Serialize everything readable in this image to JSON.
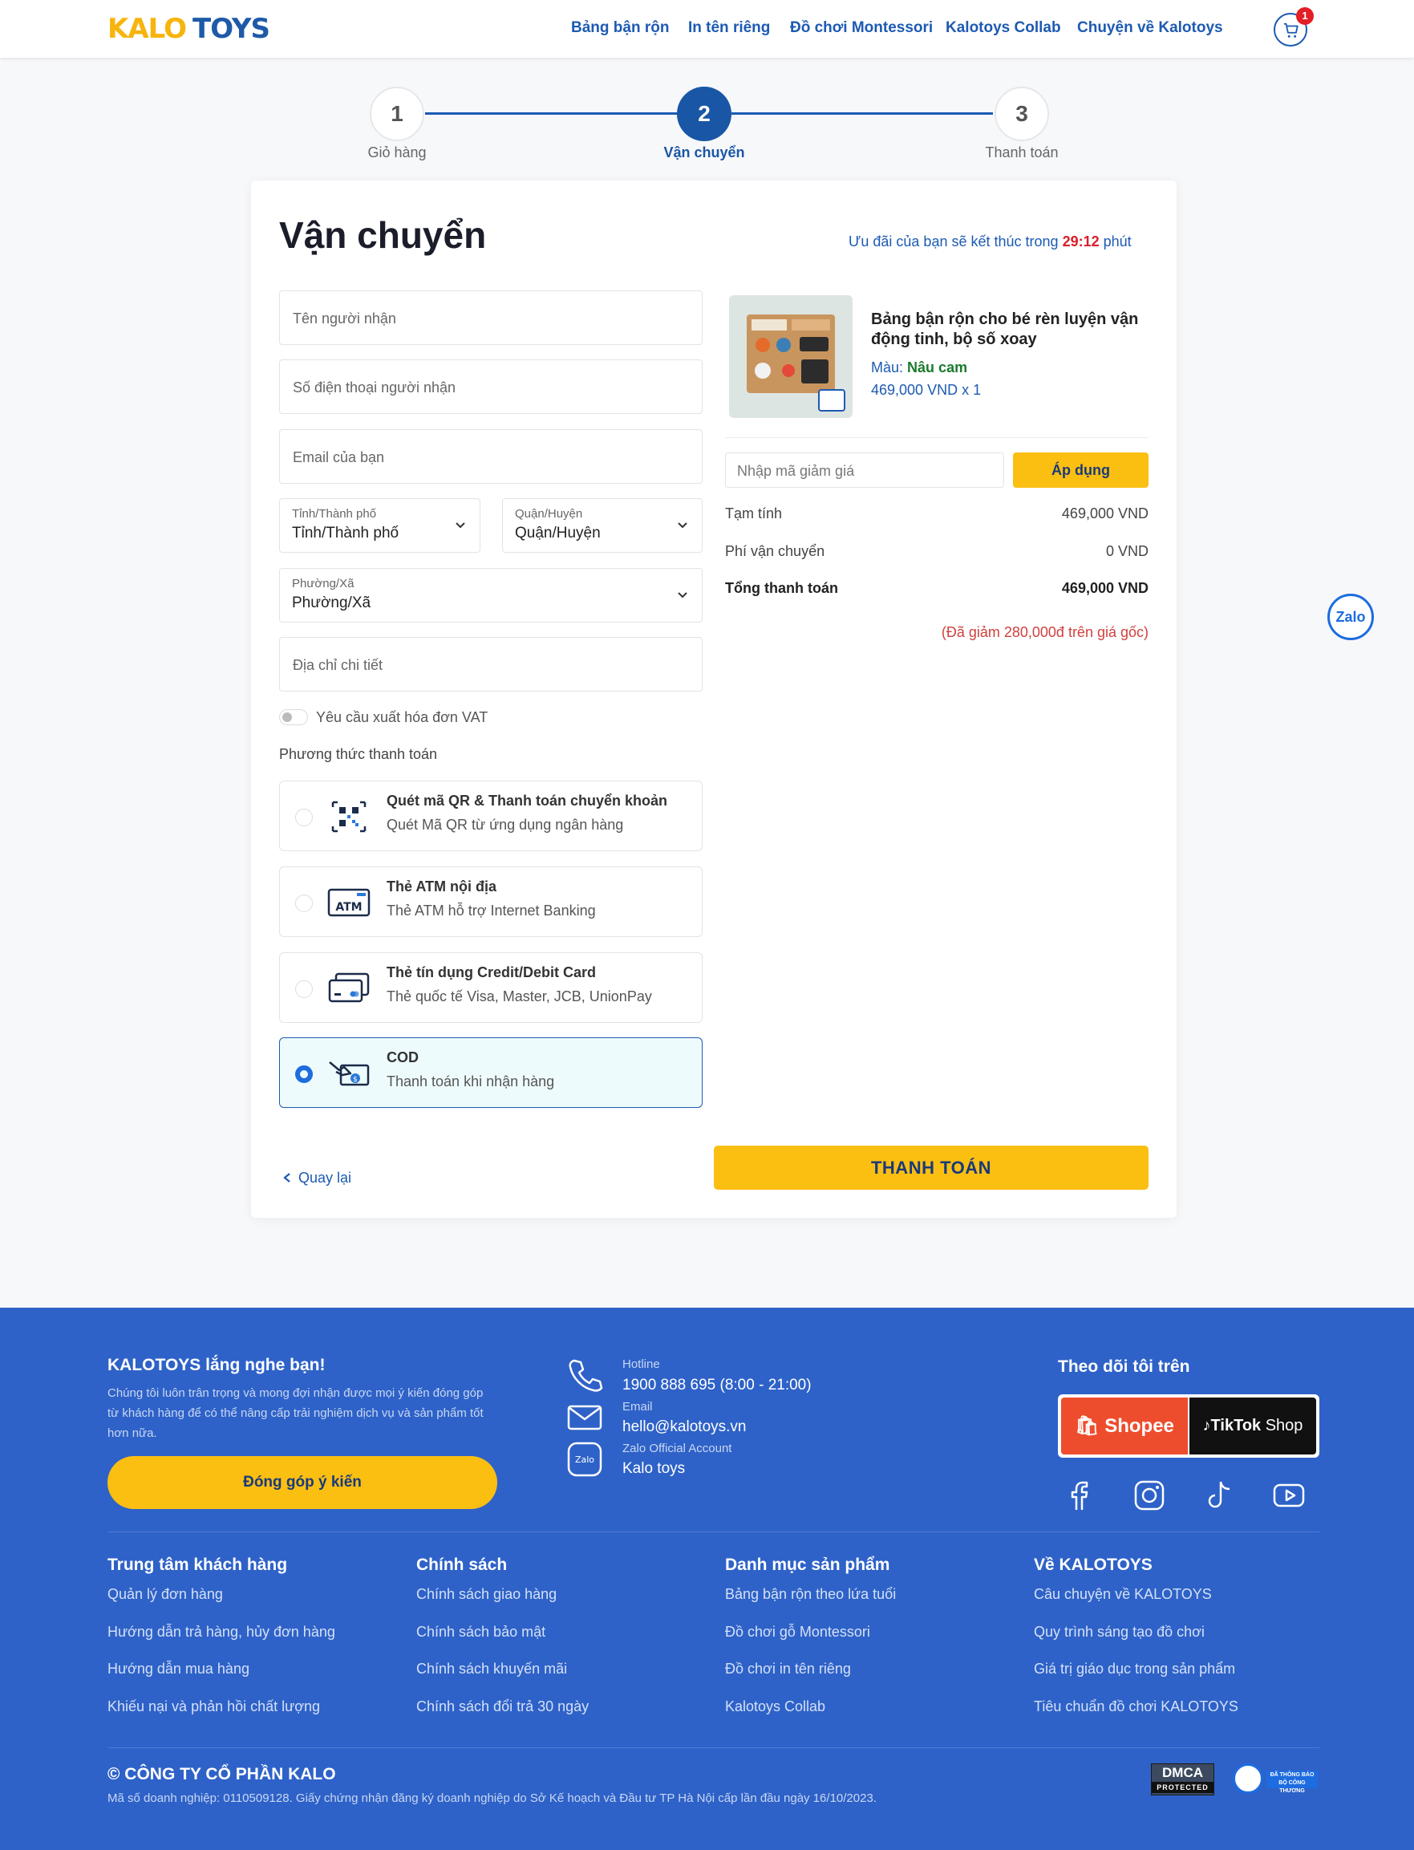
{
  "header": {
    "logo_part1": "KALO",
    "logo_part2": "TOYS",
    "nav": [
      "Bảng bận rộn",
      "In tên riêng",
      "Đồ chơi Montessori",
      "Kalotoys Collab",
      "Chuyện về Kalotoys"
    ],
    "cart_count": "1"
  },
  "stepper": {
    "steps": [
      {
        "number": "1",
        "label": "Giỏ hàng",
        "state": "done"
      },
      {
        "number": "2",
        "label": "Vận chuyển",
        "state": "active"
      },
      {
        "number": "3",
        "label": "Thanh toán",
        "state": "pending"
      }
    ]
  },
  "shipping": {
    "title": "Vận chuyển",
    "offer_prefix": "Ưu đãi của bạn sẽ kết thúc trong",
    "offer_timer": "29:12",
    "offer_suffix": "phút",
    "recipient_name_placeholder": "Tên người nhận",
    "phone_placeholder": "Số điện thoại người nhận",
    "email_placeholder": "Email của bạn",
    "province": {
      "label": "Tỉnh/Thành phố",
      "value": "Tỉnh/Thành phố"
    },
    "district": {
      "label": "Quận/Huyện",
      "value": "Quận/Huyện"
    },
    "ward": {
      "label": "Phường/Xã",
      "value": "Phường/Xã"
    },
    "address_placeholder": "Địa chỉ chi tiết",
    "vat_label": "Yêu cầu xuất hóa đơn VAT",
    "vat_enabled": false,
    "payment_title": "Phương thức thanh toán",
    "payment_methods": [
      {
        "title": "Quét mã QR & Thanh toán chuyển khoản",
        "subtitle": "Quét Mã QR từ ứng dụng ngân hàng",
        "icon": "qr-code-icon",
        "selected": false
      },
      {
        "title": "Thẻ ATM nội địa",
        "subtitle": "Thẻ ATM hỗ trợ Internet Banking",
        "icon": "atm-card-icon",
        "selected": false
      },
      {
        "title": "Thẻ tín dụng Credit/Debit Card",
        "subtitle": "Thẻ quốc tế Visa, Master, JCB, UnionPay",
        "icon": "credit-card-icon",
        "selected": false
      },
      {
        "title": "COD",
        "subtitle": "Thanh toán khi nhận hàng",
        "icon": "cash-on-delivery-icon",
        "selected": true
      }
    ],
    "back_label": "Quay lại",
    "checkout_label": "THANH TOÁN"
  },
  "order": {
    "product_name": "Bảng bận rộn cho bé rèn luyện vận động tinh, bộ số xoay",
    "color_label": "Màu:",
    "color_value": "Nâu cam",
    "price_qty": "469,000 VND x 1",
    "coupon_placeholder": "Nhập mã giảm giá",
    "apply_label": "Áp dụng",
    "subtotal_label": "Tạm tính",
    "subtotal_value": "469,000 VND",
    "shipping_label": "Phí vận chuyển",
    "shipping_value": "0 VND",
    "total_label": "Tổng thanh toán",
    "total_value": "469,000 VND",
    "discount_note": "(Đã giảm 280,000đ trên giá gốc)"
  },
  "zalo_float": "Zalo",
  "footer": {
    "listen_title": "KALOTOYS lắng nghe bạn!",
    "listen_desc": "Chúng tôi luôn trân trọng và mong đợi nhận được mọi ý kiến đóng góp từ khách hàng để có thể nâng cấp trải nghiệm dịch vụ và sản phẩm tốt hơn nữa.",
    "feedback_btn": "Đóng góp ý kiến",
    "hotline_label": "Hotline",
    "hotline_value": "1900 888 695 (8:00 - 21:00)",
    "email_label": "Email",
    "email_value": "hello@kalotoys.vn",
    "zalo_label": "Zalo Official Account",
    "zalo_value": "Kalo toys",
    "zalo_icon_text": "Zalo",
    "follow_title": "Theo dõi tôi trên",
    "shopee_label": "Shopee",
    "tiktok_label": "TikTok",
    "tiktok_shop": "Shop",
    "columns": [
      {
        "title": "Trung tâm khách hàng",
        "links": [
          "Quản lý đơn hàng",
          "Hướng dẫn trả hàng, hủy đơn hàng",
          "Hướng dẫn mua hàng",
          "Khiếu nại và phản hồi chất lượng"
        ]
      },
      {
        "title": "Chính sách",
        "links": [
          "Chính sách giao hàng",
          "Chính sách bảo mật",
          "Chính sách khuyến mãi",
          "Chính sách đổi trả 30 ngày"
        ]
      },
      {
        "title": "Danh mục sản phẩm",
        "links": [
          "Bảng bận rộn theo lứa tuổi",
          "Đồ chơi gỗ Montessori",
          "Đồ chơi in tên riêng",
          "Kalotoys Collab"
        ]
      },
      {
        "title": "Về KALOTOYS",
        "links": [
          "Câu chuyện về KALOTOYS",
          "Quy trình sáng tạo đồ chơi",
          "Giá trị giáo dục trong sản phẩm",
          "Tiêu chuẩn đồ chơi KALOTOYS"
        ]
      }
    ],
    "company": "© CÔNG TY CỔ PHẦN KALO",
    "registration": "Mã số doanh nghiệp: 0110509128. Giấy chứng nhận đăng ký doanh nghiệp do Sở Kế hoạch và Đầu tư TP Hà Nội cấp lần đầu ngày 16/10/2023.",
    "dmca_top": "DMCA",
    "dmca_bottom": "PROTECTED",
    "bct_text": "ĐÃ THÔNG BÁO BỘ CÔNG THƯƠNG"
  },
  "colors": {
    "primary": "#1d5ab2",
    "accent": "#fbbf12",
    "footer_bg": "#2e62c8",
    "timer": "#d91e2a"
  }
}
